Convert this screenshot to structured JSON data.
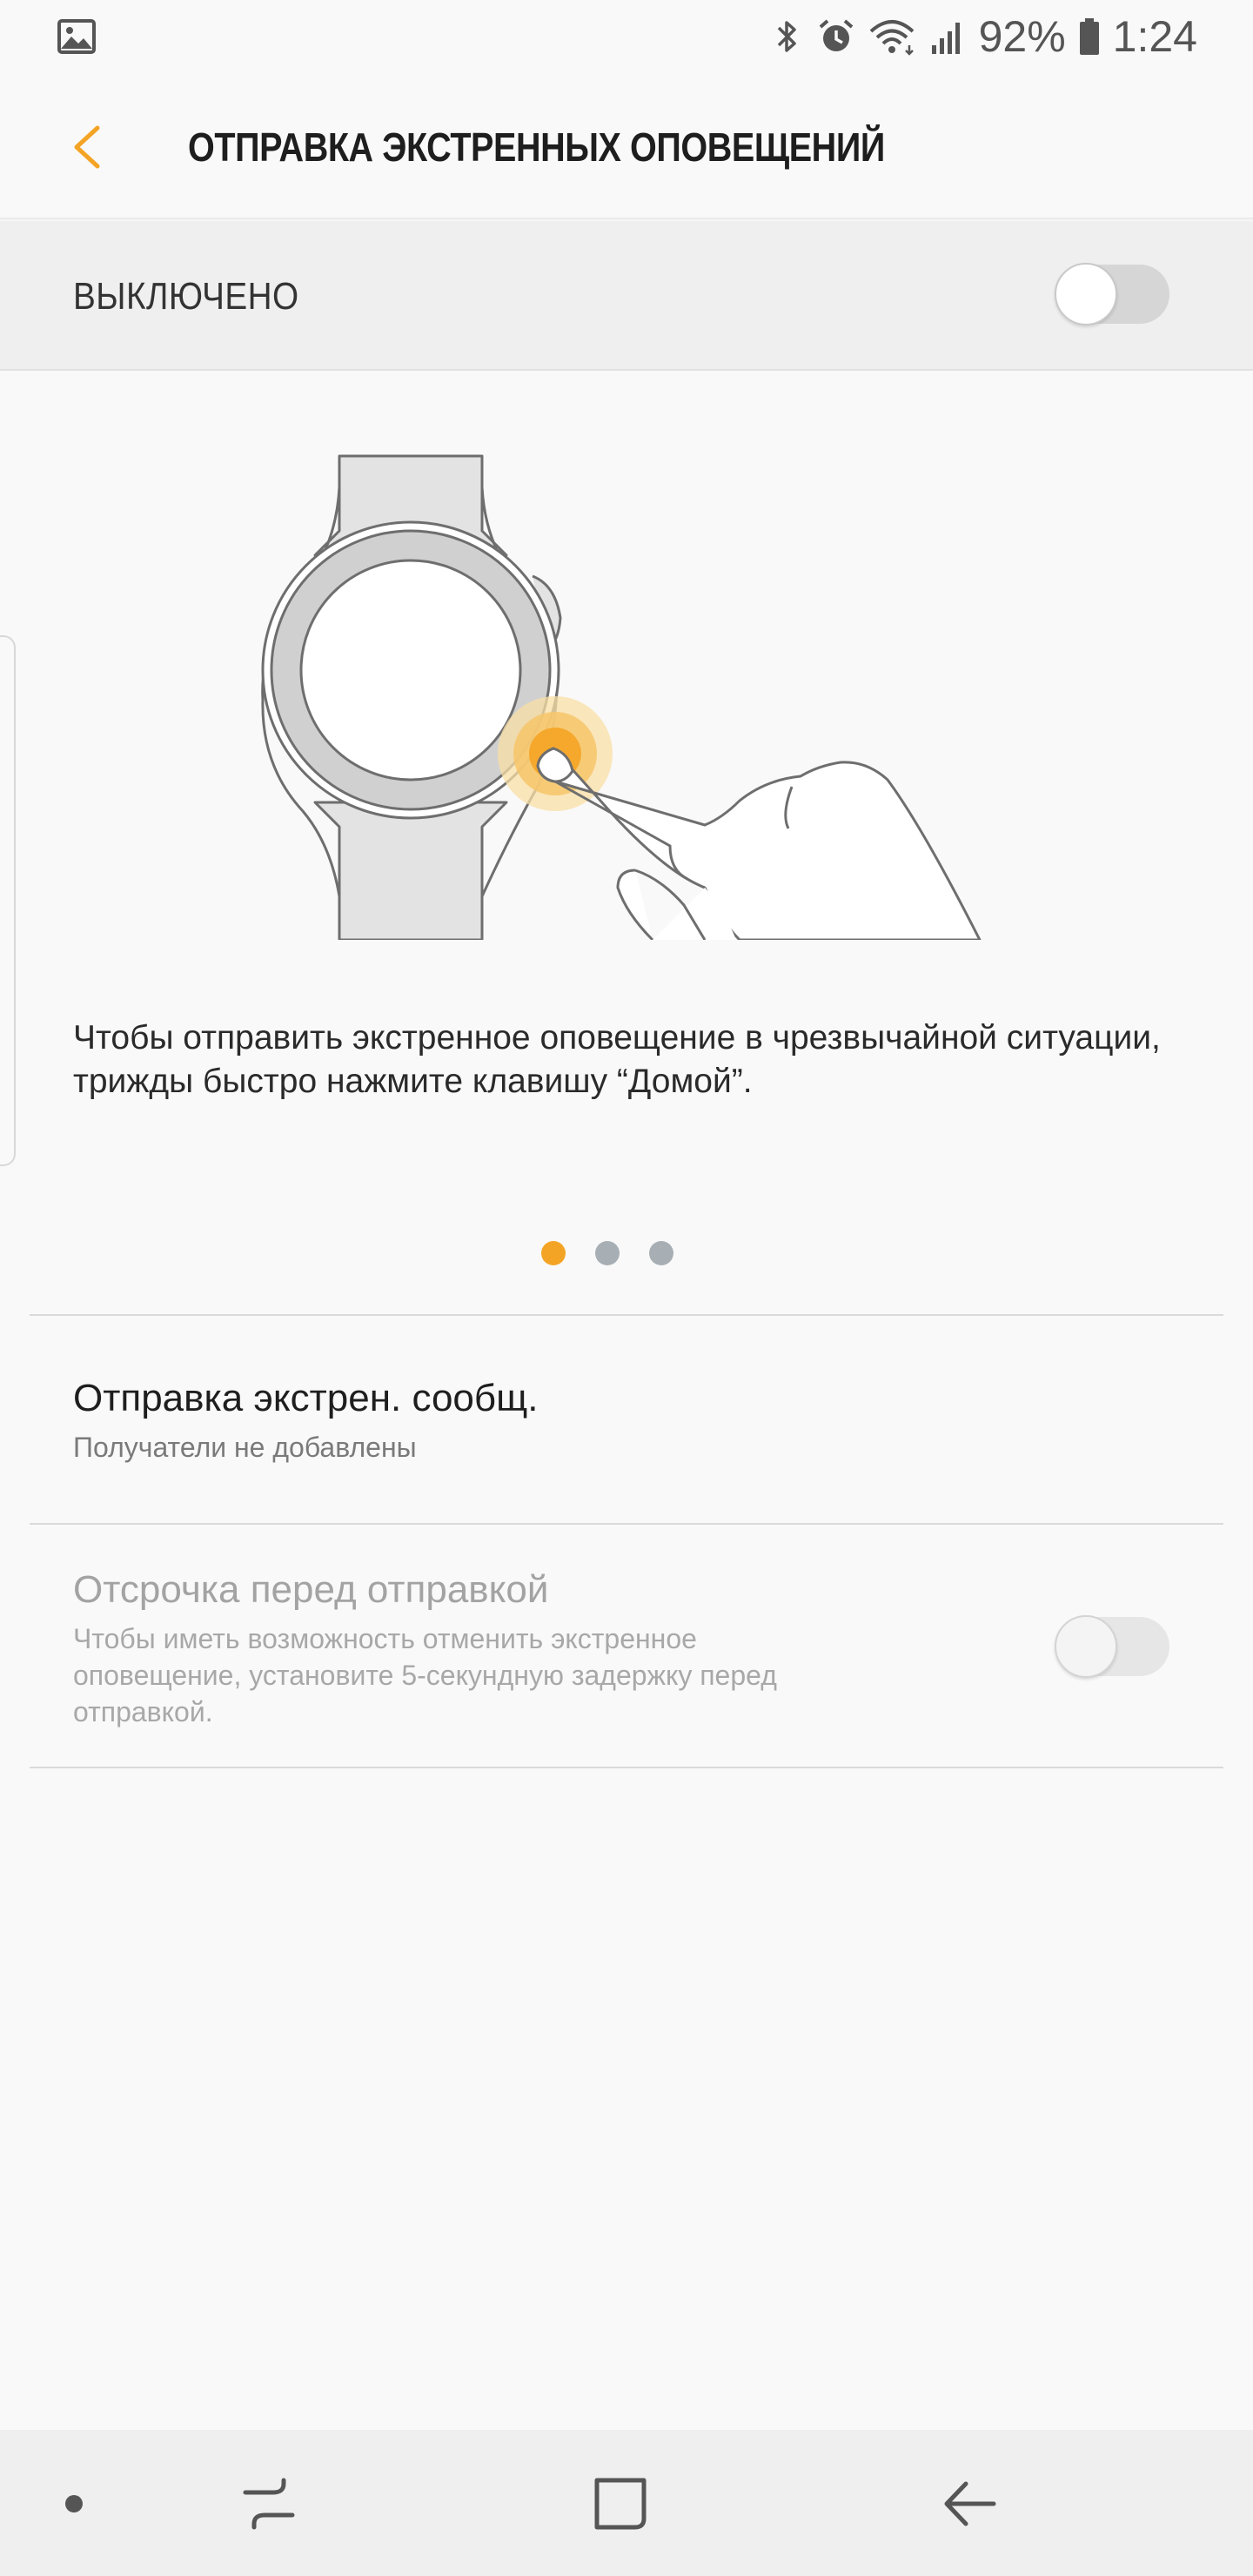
{
  "status_bar": {
    "battery": "92%",
    "time": "1:24",
    "icons": [
      "gallery-icon",
      "bluetooth-icon",
      "alarm-icon",
      "wifi-icon",
      "signal-icon",
      "battery-icon"
    ]
  },
  "header": {
    "title": "ОТПРАВКА ЭКСТРЕННЫХ ОПОВЕЩЕНИЙ",
    "back_icon": "chevron-left-icon"
  },
  "master_switch": {
    "label": "ВЫКЛЮЧЕНО",
    "on": false
  },
  "tutorial": {
    "description": "Чтобы отправить экстренное оповещение в чрезвычайной ситуации, трижды быстро нажмите клавишу “Домой”.",
    "page_count": 3,
    "current_page": 1
  },
  "settings": [
    {
      "title": "Отправка экстрен. сообщ.",
      "subtitle": "Получатели не добавлены"
    },
    {
      "title": "Отсрочка перед отправкой",
      "subtitle": "Чтобы иметь возможность отменить экстренное оповещение, установите 5-секундную задержку перед отправкой.",
      "on": false,
      "enabled": false
    }
  ],
  "nav_bar": {
    "icons": [
      "assistant-dot-icon",
      "recents-icon",
      "home-icon",
      "back-arrow-icon"
    ]
  },
  "colors": {
    "accent": "#f4a425",
    "background": "#f9f9f9",
    "switch_row_bg": "#efefef",
    "dot_inactive": "#a8afb4"
  }
}
